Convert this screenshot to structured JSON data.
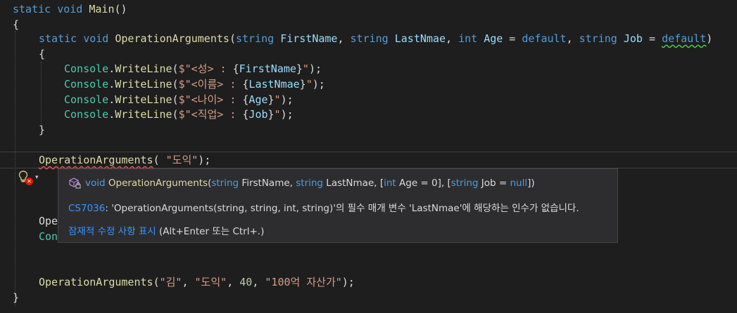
{
  "code": {
    "l1": {
      "kw1": "static",
      "kw2": "void",
      "name": "Main",
      "rest": "()"
    },
    "l2": {
      "text": "{"
    },
    "l3": {
      "kw1": "static",
      "kw2": "void",
      "name": "OperationArguments",
      "open": "(",
      "t1": "string",
      "p1": "FirstName",
      "c1": ", ",
      "t2": "string",
      "p2": "LastNmae",
      "c2": ", ",
      "t3": "int",
      "p3": "Age",
      "eq3": " = ",
      "d3": "default",
      "c3": ", ",
      "t4": "string",
      "p4": "Job",
      "eq4": " = ",
      "d4": "default",
      "close": ")"
    },
    "l4": {
      "text": "{"
    },
    "wl": [
      {
        "cls": "Console",
        "dot": ".",
        "m": "WriteLine",
        "o": "(",
        "s1": "$\"<성> : ",
        "ob": "{",
        "v": "FirstName",
        "cb": "}",
        "s2": "\"",
        "end": ");"
      },
      {
        "cls": "Console",
        "dot": ".",
        "m": "WriteLine",
        "o": "(",
        "s1": "$\"<이름> : ",
        "ob": "{",
        "v": "LastNmae",
        "cb": "}",
        "s2": "\"",
        "end": ");"
      },
      {
        "cls": "Console",
        "dot": ".",
        "m": "WriteLine",
        "o": "(",
        "s1": "$\"<나이> : ",
        "ob": "{",
        "v": "Age",
        "cb": "}",
        "s2": "\"",
        "end": ");"
      },
      {
        "cls": "Console",
        "dot": ".",
        "m": "WriteLine",
        "o": "(",
        "s1": "$\"<직업> : ",
        "ob": "{",
        "v": "Job",
        "cb": "}",
        "s2": "\"",
        "end": ");"
      }
    ],
    "l9": {
      "text": "}"
    },
    "l11": {
      "m": "OperationArguments",
      "o": "( ",
      "s": "\"도익\"",
      "end": ");"
    },
    "l12a": {
      "text": "Ope"
    },
    "l12b": {
      "text": "Con"
    },
    "l15": {
      "m": "OperationArguments",
      "o": "(",
      "s1": "\"김\"",
      "c1": ", ",
      "s2": "\"도익\"",
      "c2": ", ",
      "n": "40",
      "c3": ", ",
      "s3": "\"100억 자산가\"",
      "end": ");"
    },
    "l16": {
      "text": "}"
    }
  },
  "tooltip": {
    "icon": "cube-lock-icon",
    "sig": {
      "kw": "void",
      "name": "OperationArguments",
      "o": "(",
      "t1": "string",
      "p1": " FirstName, ",
      "t2": "string",
      "p2": " LastNmae, [",
      "t3": "int",
      "p3": " Age = 0], [",
      "t4": "string",
      "p4": " Job = ",
      "nul": "null",
      "end": "])"
    },
    "error": {
      "code": "CS7036",
      "message": ": 'OperationArguments(string, string, int, string)'의 필수 매개 변수 'LastNmae'에 해당하는 인수가 없습니다."
    },
    "fix": {
      "link": "잠재적 수정 사항 표시",
      "hint": " (Alt+Enter 또는 Ctrl+.)"
    }
  },
  "lightbulb": {
    "icon": "lightbulb-error-icon",
    "dropdown": "▾"
  },
  "colors": {
    "keyword": "#569cd6",
    "method": "#dcdcaa",
    "param": "#9cdcfe",
    "class": "#4ec9b0",
    "string": "#d69d85",
    "number": "#b5cea8",
    "link": "#3794ff",
    "error": "#f14c4c"
  }
}
